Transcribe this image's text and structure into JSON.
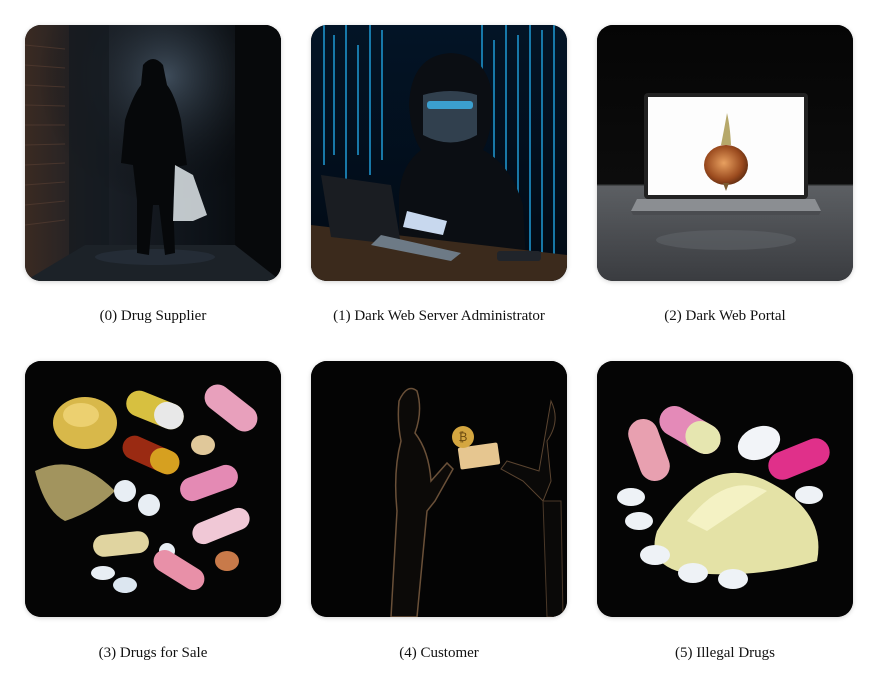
{
  "panels": [
    {
      "index": "(0)",
      "label": "Drug Supplier",
      "icon": "hooded-figure-alley-image"
    },
    {
      "index": "(1)",
      "label": "Dark Web Server Administrator",
      "icon": "hacker-laptop-image"
    },
    {
      "index": "(2)",
      "label": "Dark Web Portal",
      "icon": "onion-laptop-image"
    },
    {
      "index": "(3)",
      "label": "Drugs for Sale",
      "icon": "pills-powder-image"
    },
    {
      "index": "(4)",
      "label": "Customer",
      "icon": "bitcoin-exchange-image"
    },
    {
      "index": "(5)",
      "label": "Illegal Drugs",
      "icon": "pills-pile-image"
    }
  ],
  "colors": {
    "background": "#ffffff",
    "caption_text": "#111111",
    "tile_background": "#000000"
  }
}
